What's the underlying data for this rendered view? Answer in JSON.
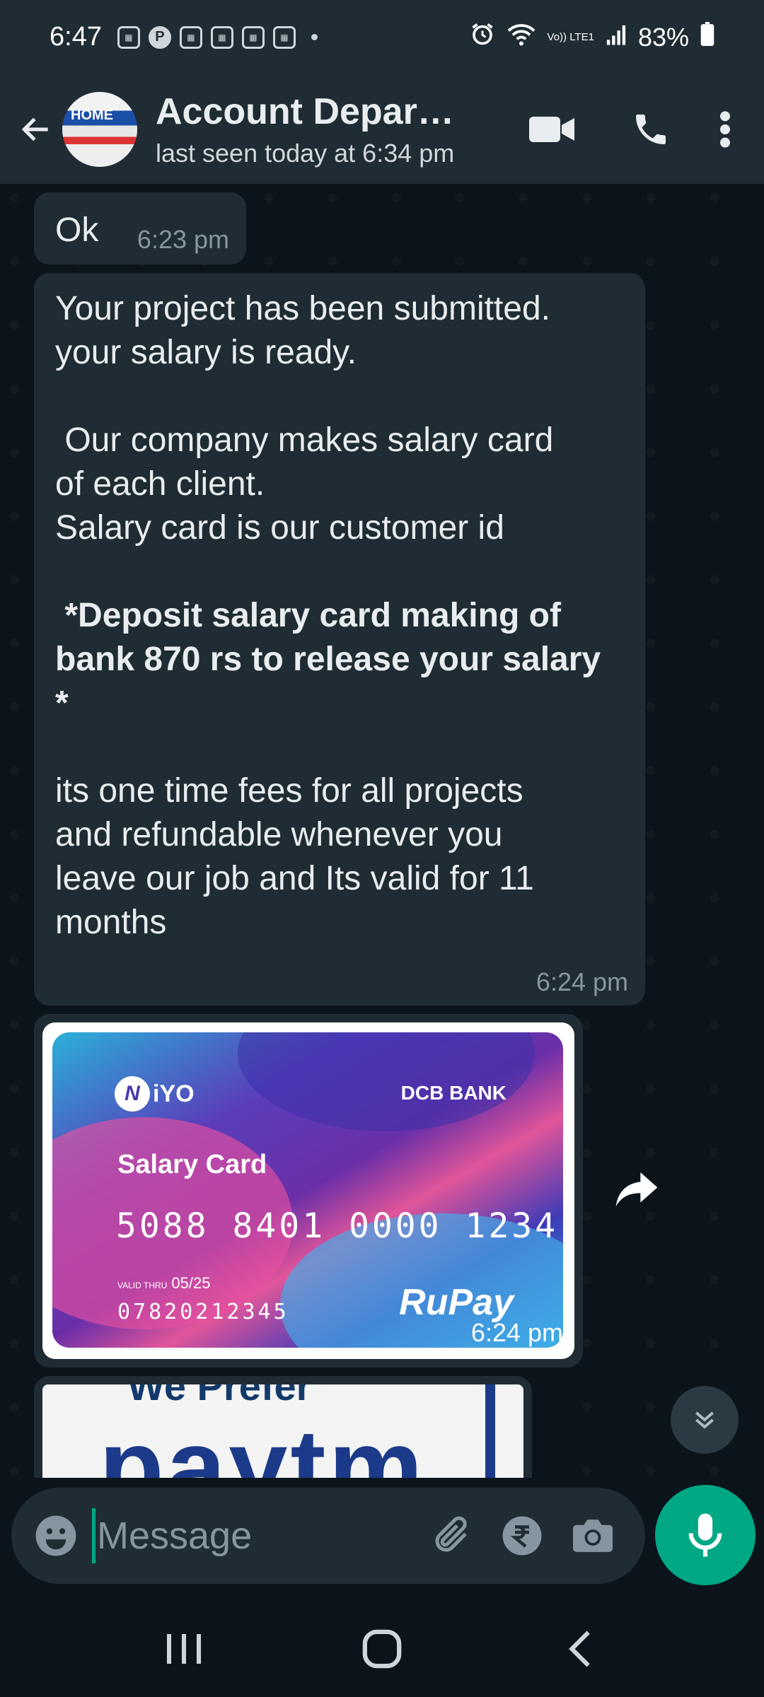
{
  "status_bar": {
    "time": "6:47",
    "notifications": [
      "calendar-grid-icon",
      "pinterest-icon",
      "calendar-grid-icon",
      "calendar-grid-icon",
      "calendar-grid-icon",
      "calendar-grid-icon"
    ],
    "volte": "Vo)) LTE1",
    "battery": "83%"
  },
  "header": {
    "contact_name": "Account Depart...",
    "contact_status": "last seen today at 6:34 pm",
    "avatar_text": "HOME"
  },
  "messages": [
    {
      "text": "Ok",
      "time": "6:23 pm"
    },
    {
      "part1": "Your project has been submitted.\nyour salary is ready.\n\n Our company makes salary card\nof each client.\nSalary card is our customer id\n\n",
      "bold": " *Deposit salary card making of\nbank 870 rs to release your salary\n*",
      "part2": "\n\nits one time fees for all projects\nand refundable whenever you\nleave our job and Its valid for 11\nmonths",
      "time": "6:24 pm"
    },
    {
      "card": {
        "brand_logo": "iYO",
        "bank": "DCB BANK",
        "title": "Salary Card",
        "number": "5088 8401 0000 1234",
        "valid_label": "VALID THRU",
        "valid": "05/25",
        "account": "07820212345",
        "network": "RuPay"
      },
      "time": "6:24 pm"
    },
    {
      "image_top_text": "We Prefer",
      "image_word": "paytm"
    }
  ],
  "composer": {
    "placeholder": "Message"
  },
  "colors": {
    "accent": "#00a884",
    "bubble": "#202c33",
    "background": "#0b141a"
  }
}
